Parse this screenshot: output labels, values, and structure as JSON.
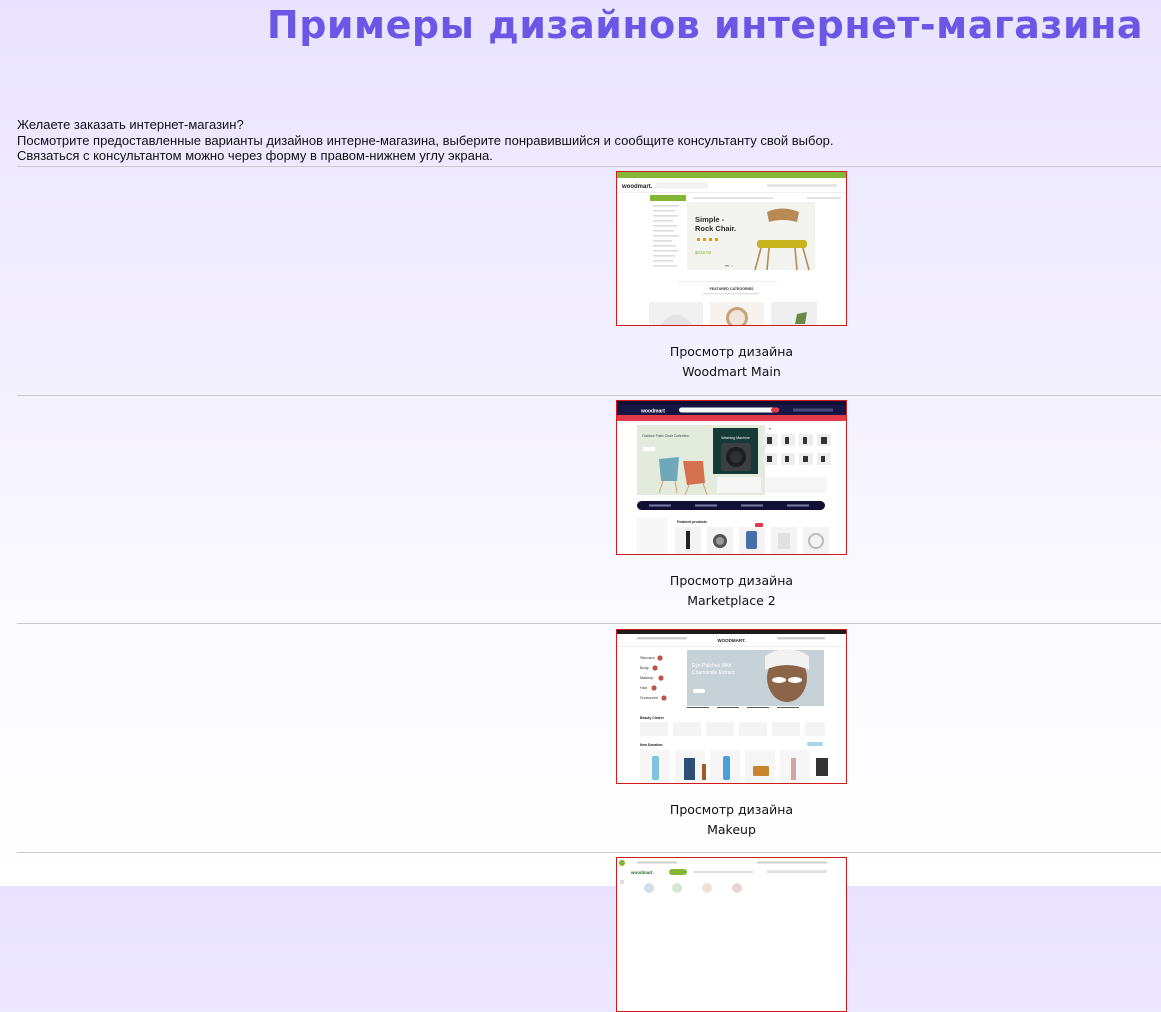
{
  "page": {
    "title": "Примеры дизайнов интернет-магазина",
    "intro": [
      "Желаете заказать интернет-магазин?",
      "Посмотрите предоставленные варианты дизайнов интерне-магазина, выберите понравившийся и сообщите консультанту свой выбор.",
      "Связаться с консультантом можно через форму в правом-нижнем углу экрана."
    ]
  },
  "colors": {
    "title": "#6c56e6",
    "thumb_border": "#d11a1a",
    "divider": "#c9c9c9"
  },
  "designs": [
    {
      "caption_line1": "Просмотр дизайна",
      "caption_line2": "Woodmart Main",
      "thumb": {
        "logo": "woodmart.",
        "hero_title_1": "Simple -",
        "hero_title_2": "Rock Chair.",
        "price": "$219.00",
        "section": "FEATURED CATEGORIES"
      }
    },
    {
      "caption_line1": "Просмотр дизайна",
      "caption_line2": "Marketplace 2",
      "thumb": {
        "logo": "woodmart",
        "hero_text": "Outdoor Patio Chair Collection",
        "promo": "Washing Machine",
        "section": "Featured products"
      }
    },
    {
      "caption_line1": "Просмотр дизайна",
      "caption_line2": "Makeup",
      "thumb": {
        "logo": "WOODMART.",
        "hero_title_1": "Eye Patches With",
        "hero_title_2": "Chamomile Extract",
        "categories": [
          "Skincare",
          "Body",
          "Makeup",
          "Hair",
          "Sunscreen"
        ],
        "section_1": "Beauty Clearer",
        "section_2": "New Donation"
      }
    },
    {
      "thumb": {
        "logo": "woodmart."
      }
    }
  ]
}
